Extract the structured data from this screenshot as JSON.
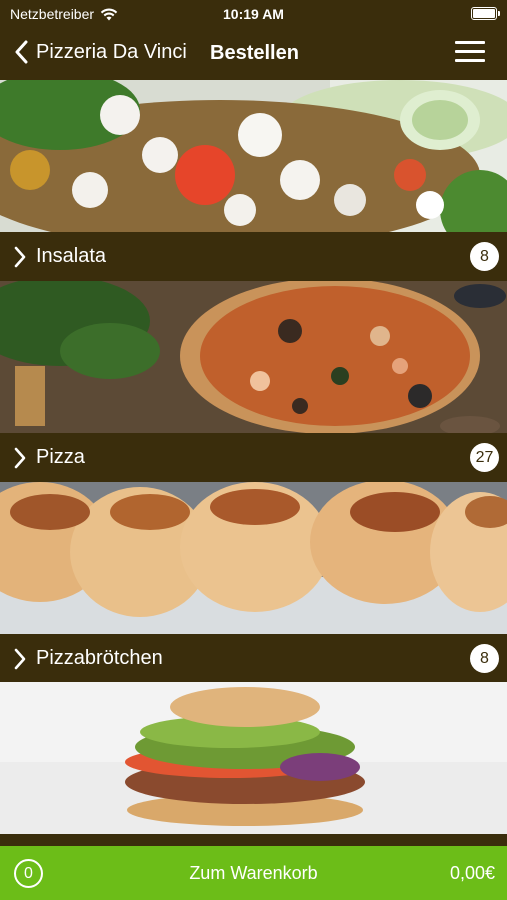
{
  "status_bar": {
    "carrier": "Netzbetreiber",
    "time": "10:19 AM",
    "wifi_icon": "wifi-icon",
    "battery_icon": "battery-icon",
    "battery_level": 1.0
  },
  "nav": {
    "back_label": "Pizzeria Da Vinci",
    "title": "Bestellen",
    "back_icon": "chevron-left-icon",
    "menu_icon": "hamburger-menu-icon"
  },
  "categories": [
    {
      "label": "Insalata",
      "count": "8",
      "image": "salad-photo"
    },
    {
      "label": "Pizza",
      "count": "27",
      "image": "pizza-photo"
    },
    {
      "label": "Pizzabrötchen",
      "count": "8",
      "image": "pizza-rolls-photo"
    },
    {
      "label": "",
      "count": "",
      "image": "doner-sandwich-photo"
    }
  ],
  "cart": {
    "count": "0",
    "label": "Zum Warenkorb",
    "total": "0,00€"
  },
  "colors": {
    "brand_dark": "#3a2d0c",
    "cart_green": "#6cbd18",
    "badge_bg": "#ffffff"
  }
}
